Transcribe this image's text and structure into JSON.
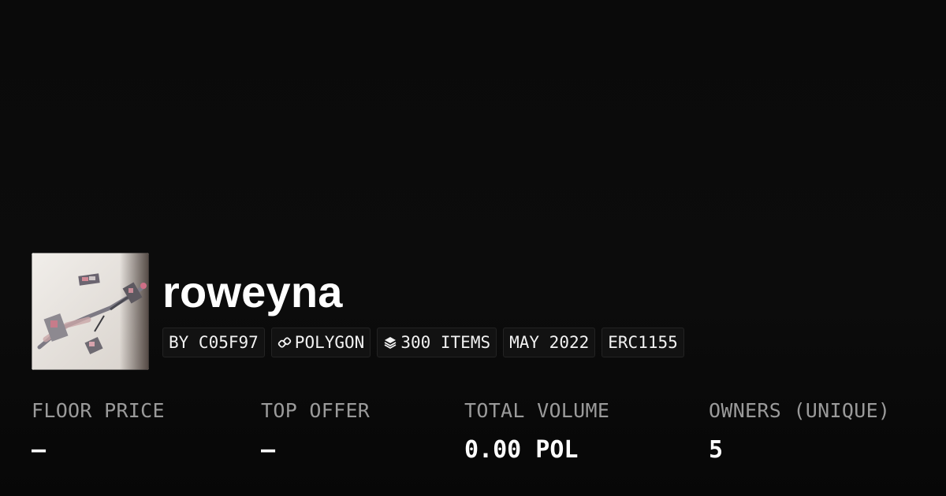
{
  "collection": {
    "name": "roweyna",
    "badges": {
      "creator": "BY C05F97",
      "chain": "POLYGON",
      "items": "300 ITEMS",
      "date": "MAY 2022",
      "standard": "ERC1155"
    }
  },
  "stats": [
    {
      "label": "FLOOR PRICE",
      "value": "–"
    },
    {
      "label": "TOP OFFER",
      "value": "–"
    },
    {
      "label": "TOTAL VOLUME",
      "value": "0.00 POL"
    },
    {
      "label": "OWNERS (UNIQUE)",
      "value": "5"
    }
  ],
  "icons": {
    "chain": "link-icon",
    "items": "layers-icon"
  },
  "colors": {
    "background": "#0a0a0a",
    "badge_background": "#121212",
    "badge_border": "#232323",
    "label": "#9a9a9a",
    "text": "#ffffff"
  }
}
